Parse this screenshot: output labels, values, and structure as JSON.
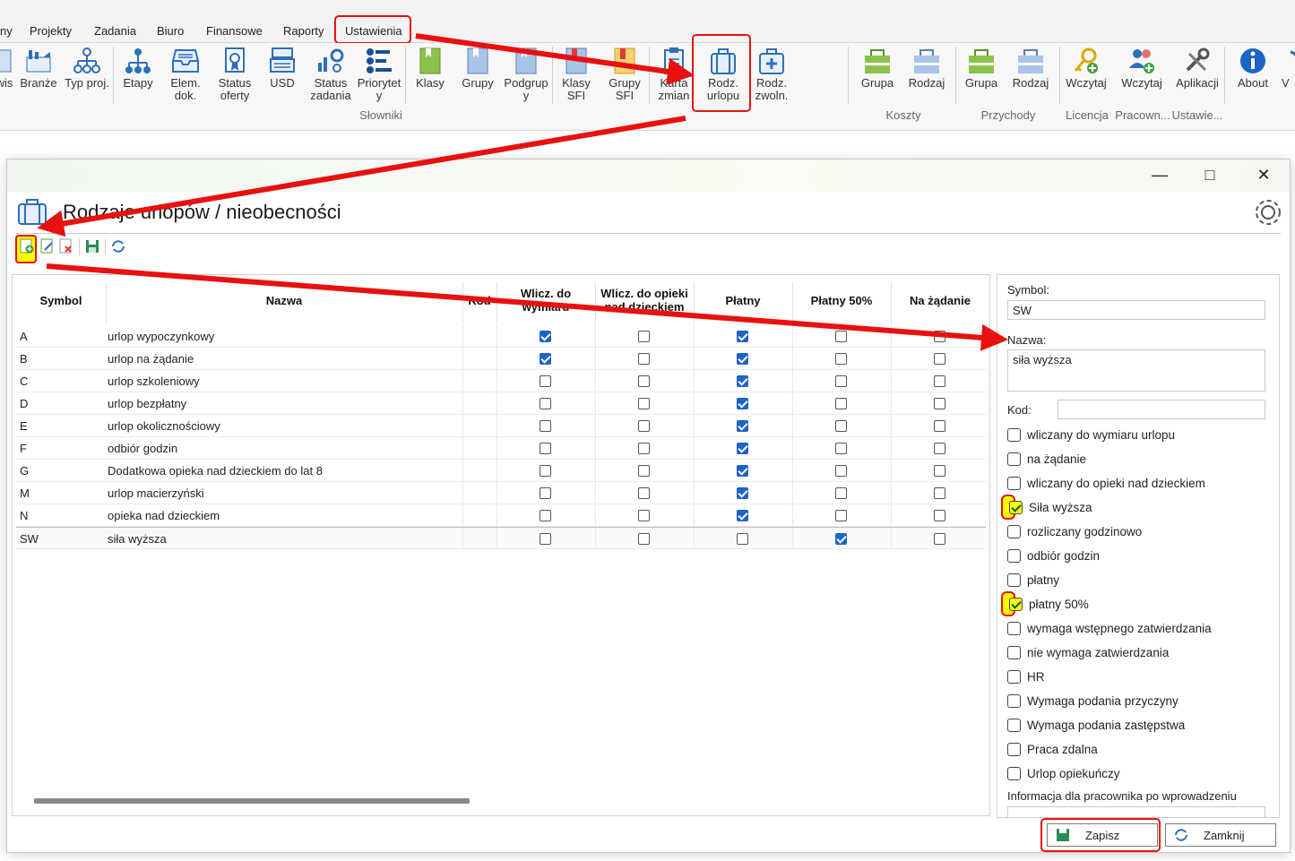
{
  "menu": {
    "items": [
      "ny",
      "Projekty",
      "Zadania",
      "Biuro",
      "Finansowe",
      "Raporty",
      "Ustawienia"
    ]
  },
  "ribbon": {
    "buttons": {
      "wis": "wis",
      "branze": "Branże",
      "typ_proj": "Typ proj.",
      "etapy": "Etapy",
      "elem_dok_1": "Elem.",
      "elem_dok_2": "dok.",
      "status_oferty_1": "Status",
      "status_oferty_2": "oferty",
      "usd": "USD",
      "status_zadania_1": "Status",
      "status_zadania_2": "zadania",
      "priorytety_1": "Priorytet",
      "priorytety_2": "y",
      "klasy": "Klasy",
      "grupy": "Grupy",
      "podgrupy_1": "Podgrup",
      "podgrupy_2": "y",
      "klasy_sfi_1": "Klasy",
      "klasy_sfi_2": "SFI",
      "grupy_sfi_1": "Grupy",
      "grupy_sfi_2": "SFI",
      "karta_zmian_1": "Karta",
      "karta_zmian_2": "zmian",
      "rodz_urlopu_1": "Rodz.",
      "rodz_urlopu_2": "urlopu",
      "rodz_zwoln_1": "Rodz.",
      "rodz_zwoln_2": "zwoln.",
      "koszty_grupa": "Grupa",
      "koszty_rodzaj": "Rodzaj",
      "przychody_grupa": "Grupa",
      "przychody_rodzaj": "Rodzaj",
      "licencja_wczytaj": "Wczytaj",
      "pracown_wczytaj": "Wczytaj",
      "aplikacji": "Aplikacji",
      "about": "About",
      "v": "V"
    },
    "groups": {
      "slowniki": "Słowniki",
      "koszty": "Koszty",
      "przychody": "Przychody",
      "licencja": "Licencja",
      "pracown": "Pracown...",
      "ustawie": "Ustawie..."
    }
  },
  "dialog": {
    "title": "Rodzaje urlopów / nieobecności",
    "columns": [
      "Symbol",
      "Nazwa",
      "Kod",
      "Wlicz. do wymiaru",
      "Wlicz. do opieki nad dzieckiem",
      "Płatny",
      "Płatny 50%",
      "Na żądanie"
    ],
    "rows": [
      {
        "symbol": "A",
        "nazwa": "urlop wypoczynkowy",
        "flags": [
          true,
          false,
          true,
          false,
          false
        ]
      },
      {
        "symbol": "B",
        "nazwa": "urlop na żądanie",
        "flags": [
          true,
          false,
          true,
          false,
          false
        ]
      },
      {
        "symbol": "C",
        "nazwa": "urlop szkoleniowy",
        "flags": [
          false,
          false,
          true,
          false,
          false
        ]
      },
      {
        "symbol": "D",
        "nazwa": "urlop bezpłatny",
        "flags": [
          false,
          false,
          true,
          false,
          false
        ]
      },
      {
        "symbol": "E",
        "nazwa": "urlop okolicznościowy",
        "flags": [
          false,
          false,
          true,
          false,
          false
        ]
      },
      {
        "symbol": "F",
        "nazwa": "odbiór godzin",
        "flags": [
          false,
          false,
          true,
          false,
          false
        ]
      },
      {
        "symbol": "G",
        "nazwa": "Dodatkowa opieka nad dzieckiem do lat 8",
        "flags": [
          false,
          false,
          true,
          false,
          false
        ]
      },
      {
        "symbol": "M",
        "nazwa": "urlop macierzyński",
        "flags": [
          false,
          false,
          true,
          false,
          false
        ]
      },
      {
        "symbol": "N",
        "nazwa": "opieka nad dzieckiem",
        "flags": [
          false,
          false,
          true,
          false,
          false
        ]
      },
      {
        "symbol": "SW",
        "nazwa": "siła wyższa",
        "flags": [
          false,
          false,
          false,
          true,
          false
        ]
      }
    ],
    "form": {
      "symbol_label": "Symbol:",
      "symbol_value": "SW",
      "nazwa_label": "Nazwa:",
      "nazwa_value": "siła wyższa",
      "kod_label": "Kod:",
      "kod_value": "",
      "options": [
        {
          "label": "wliczany do wymiaru urlopu",
          "checked": false,
          "highlight": false
        },
        {
          "label": "na żądanie",
          "checked": false,
          "highlight": false
        },
        {
          "label": "wliczany do opieki nad dzieckiem",
          "checked": false,
          "highlight": false
        },
        {
          "label": "Siła wyższa",
          "checked": true,
          "highlight": true
        },
        {
          "label": "rozliczany godzinowo",
          "checked": false,
          "highlight": false
        },
        {
          "label": "odbiór godzin",
          "checked": false,
          "highlight": false
        },
        {
          "label": "płatny",
          "checked": false,
          "highlight": false
        },
        {
          "label": "płatny 50%",
          "checked": true,
          "highlight": true
        },
        {
          "label": "wymaga wstępnego zatwierdzania",
          "checked": false,
          "highlight": false
        },
        {
          "label": "nie wymaga zatwierdzania",
          "checked": false,
          "highlight": false
        },
        {
          "label": "HR",
          "checked": false,
          "highlight": false
        },
        {
          "label": "Wymaga podania przyczyny",
          "checked": false,
          "highlight": false
        },
        {
          "label": "Wymaga podania zastępstwa",
          "checked": false,
          "highlight": false
        },
        {
          "label": "Praca zdalna",
          "checked": false,
          "highlight": false
        },
        {
          "label": "Urlop opiekuńczy",
          "checked": false,
          "highlight": false
        }
      ],
      "info_label": "Informacja dla pracownika po wprowadzeniu"
    },
    "buttons": {
      "save": "Zapisz",
      "close": "Zamknij"
    }
  },
  "colors": {
    "highlight": "#ffff00",
    "annotation_red": "#e81010",
    "checkbox_blue": "#1e63c8"
  }
}
